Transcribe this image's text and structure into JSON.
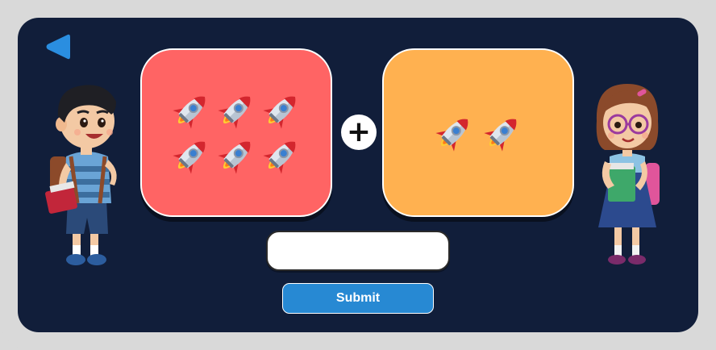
{
  "game": {
    "back_icon": "back-triangle-icon",
    "left_group": {
      "item_icon": "rocket-emoji",
      "count": 6
    },
    "right_group": {
      "item_icon": "rocket-emoji",
      "count": 2
    },
    "operator": "+",
    "answer": {
      "value": "",
      "placeholder": ""
    },
    "submit_label": "Submit"
  },
  "colors": {
    "frame": "#d9d9d9",
    "stage": "#111e3a",
    "left_card": "#ff6464",
    "right_card": "#ffb150",
    "accent": "#2789d3"
  }
}
